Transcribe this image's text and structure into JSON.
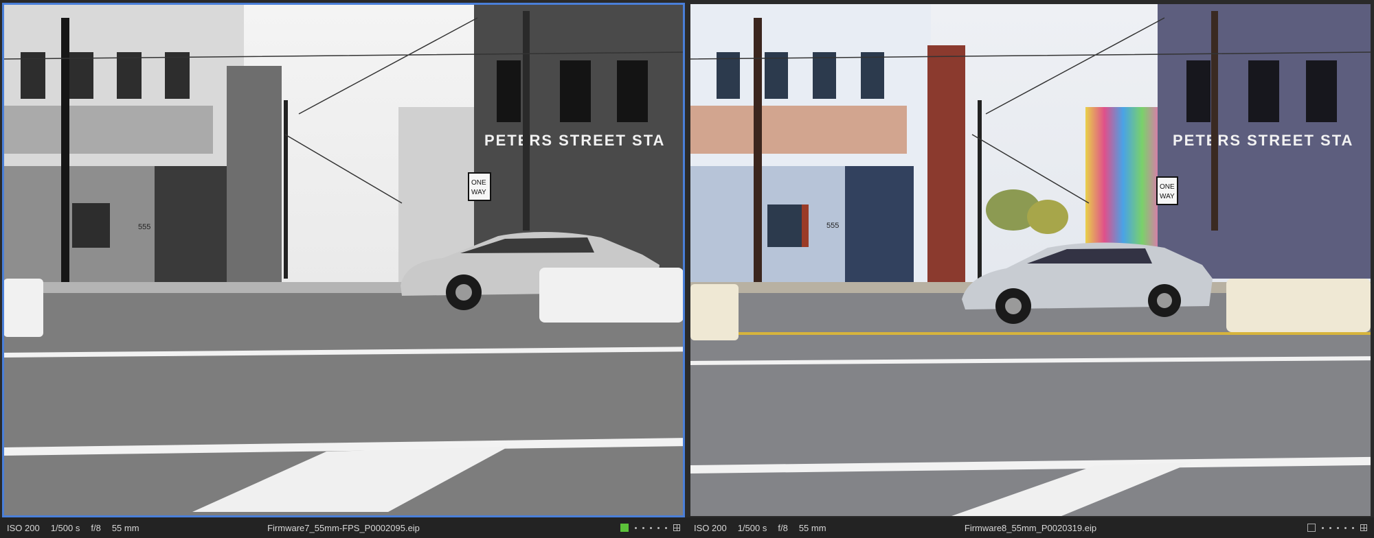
{
  "left_viewer": {
    "iso": "ISO 200",
    "shutter": "1/500 s",
    "aperture": "f/8",
    "focal_length": "55 mm",
    "filename": "Firmware7_55mm-FPS_P0002095.eip",
    "color_label": "green",
    "selected": true,
    "mode": "black & white"
  },
  "right_viewer": {
    "iso": "ISO 200",
    "shutter": "1/500 s",
    "aperture": "f/8",
    "focal_length": "55 mm",
    "filename": "Firmware8_55mm_P0020319.eip",
    "color_label": "none",
    "selected": false,
    "mode": "color"
  },
  "scene_text": {
    "building_sign": "PETERS STREET STA",
    "one_way_top": "ONE",
    "one_way_bottom": "WAY",
    "address": "555"
  },
  "colors": {
    "selection_border": "#4a7fd9",
    "green_label": "#5cc23a"
  }
}
